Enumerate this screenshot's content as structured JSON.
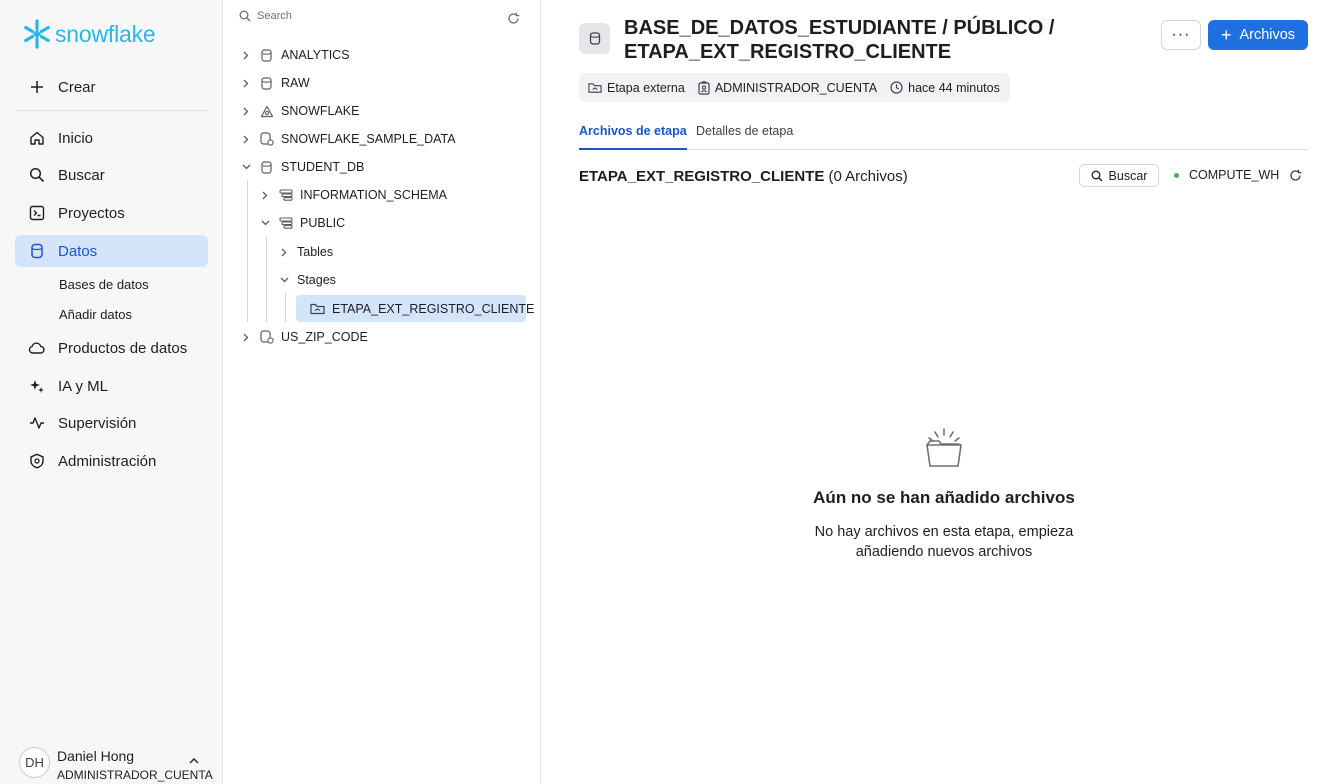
{
  "brand": {
    "logo_text": "snowflake",
    "color": "#29b5e8"
  },
  "nav": {
    "create_label": "Crear",
    "items": [
      {
        "label": "Inicio",
        "icon": "home-icon"
      },
      {
        "label": "Buscar",
        "icon": "search-icon"
      },
      {
        "label": "Proyectos",
        "icon": "projects-icon"
      },
      {
        "label": "Datos",
        "icon": "database-icon",
        "active": true
      },
      {
        "label": "Productos de datos",
        "icon": "cloud-icon"
      },
      {
        "label": "IA y ML",
        "icon": "sparkle-icon"
      },
      {
        "label": "Supervisión",
        "icon": "activity-icon"
      },
      {
        "label": "Administración",
        "icon": "shield-icon"
      }
    ],
    "sub_items": [
      {
        "label": "Bases de datos"
      },
      {
        "label": "Añadir datos"
      }
    ],
    "active_color": "#d4e5fb"
  },
  "user": {
    "initials": "DH",
    "name": "Daniel Hong",
    "role": "ADMINISTRADOR_CUENTA"
  },
  "tree": {
    "search_placeholder": "Search",
    "rows": [
      {
        "label": "ANALYTICS",
        "icon": "database-icon",
        "expanded": false
      },
      {
        "label": "RAW",
        "icon": "database-icon",
        "expanded": false
      },
      {
        "label": "SNOWFLAKE",
        "icon": "shared-database-icon",
        "expanded": false
      },
      {
        "label": "SNOWFLAKE_SAMPLE_DATA",
        "icon": "shared-database-icon",
        "expanded": false
      },
      {
        "label": "STUDENT_DB",
        "icon": "database-icon",
        "expanded": true
      },
      {
        "label": "INFORMATION_SCHEMA",
        "icon": "schema-icon",
        "expanded": false
      },
      {
        "label": "PUBLIC",
        "icon": "schema-icon",
        "expanded": true
      },
      {
        "label": "Tables",
        "expanded": false
      },
      {
        "label": "Stages",
        "expanded": true
      },
      {
        "label": "ETAPA_EXT_REGISTRO_CLIENTE",
        "icon": "stage-icon",
        "selected": true
      },
      {
        "label": "US_ZIP_CODE",
        "icon": "shared-database-icon",
        "expanded": false
      }
    ]
  },
  "main": {
    "title": "BASE_DE_DATOS_ESTUDIANTE / PÚBLICO / ETAPA_EXT_REGISTRO_CLIENTE",
    "more_label": "···",
    "files_button_label": "Archivos",
    "meta": {
      "type": "Etapa externa",
      "owner": "ADMINISTRADOR_CUENTA",
      "modified": "hace 44 minutos"
    },
    "tabs": [
      {
        "label": "Archivos de etapa",
        "active": true
      },
      {
        "label": "Detalles de etapa",
        "active": false
      }
    ],
    "stage_name": "ETAPA_EXT_REGISTRO_CLIENTE",
    "file_count": "(0 Archivos)",
    "search_label": "Buscar",
    "warehouse": "COMPUTE_WH",
    "empty_title": "Aún no se han añadido archivos",
    "empty_desc": "No hay archivos en esta etapa, empieza añadiendo nuevos archivos",
    "accent": "#1f6fe0"
  }
}
